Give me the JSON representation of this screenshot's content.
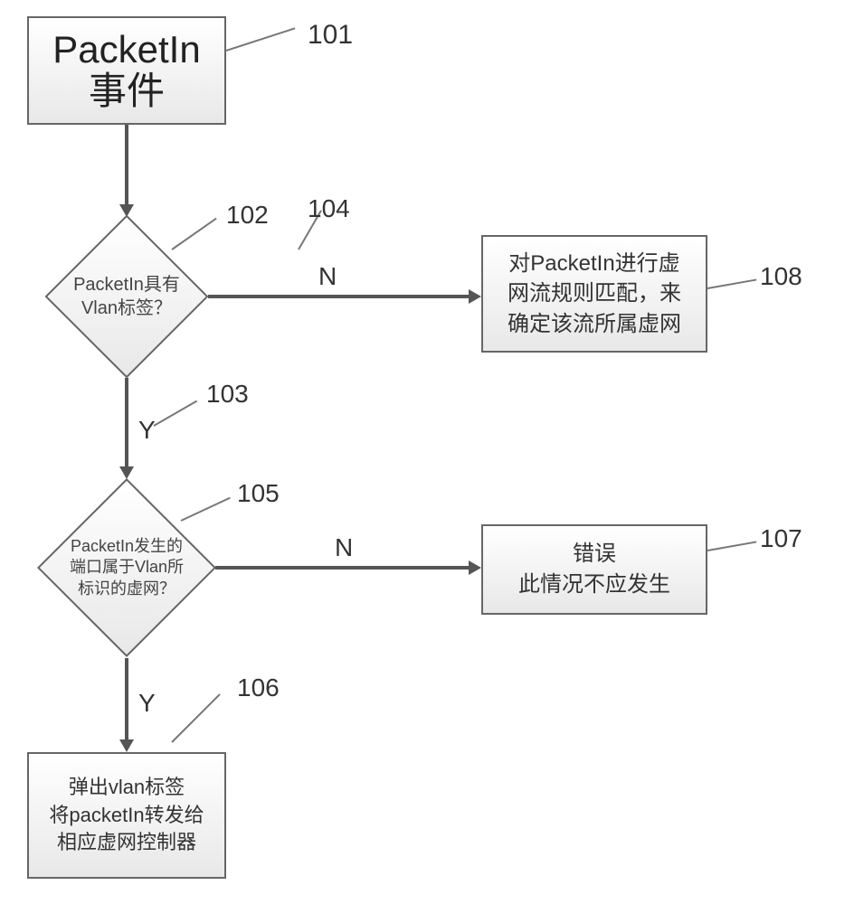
{
  "nodes": {
    "start": {
      "id": "101",
      "line1": "PacketIn",
      "line2": "事件"
    },
    "d1": {
      "id": "102",
      "text": "PacketIn具有\nVlan标签？"
    },
    "d2": {
      "id": "105",
      "text": "PacketIn发生的\n端口属于Vlan所\n标识的虚网？"
    },
    "p1": {
      "id": "108",
      "text": "对PacketIn进行虚\n网流规则匹配，来\n确定该流所属虚网"
    },
    "p2": {
      "id": "107",
      "text": "错误\n此情况不应发生"
    },
    "p3": {
      "id": "106",
      "text": "弹出vlan标签\n将packetIn转发给\n相应虚网控制器"
    }
  },
  "edges": {
    "d1_yes": {
      "id": "103",
      "label": "Y"
    },
    "d1_no": {
      "id": "104",
      "label": "N"
    },
    "d2_yes": {
      "label": "Y"
    },
    "d2_no": {
      "label": "N"
    }
  }
}
